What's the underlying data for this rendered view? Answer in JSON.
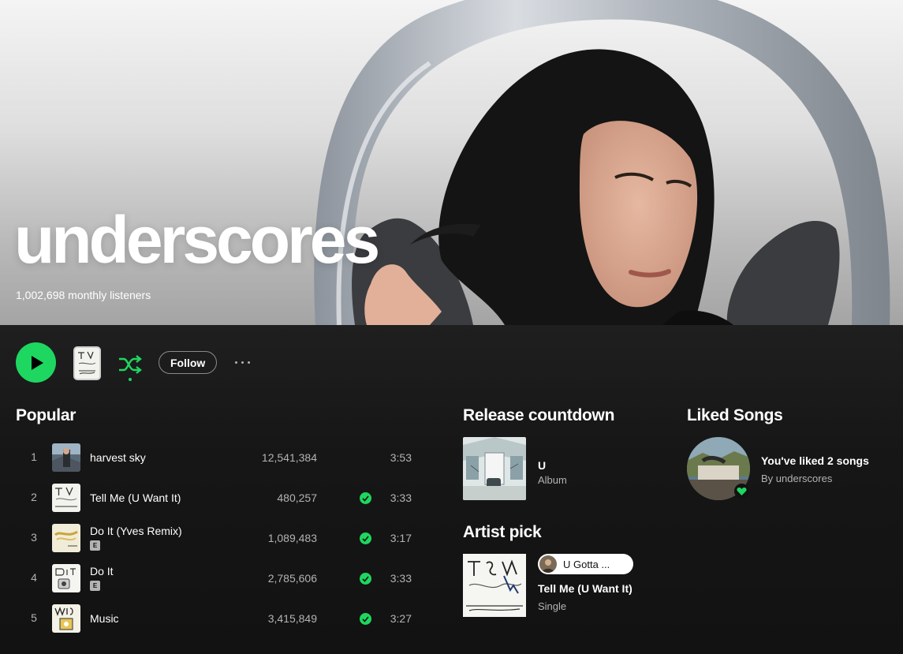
{
  "artist": {
    "name": "underscores",
    "monthly_listeners": "1,002,698 monthly listeners"
  },
  "actions": {
    "play_icon": "play-icon",
    "shuffle_icon": "shuffle-icon",
    "follow_label": "Follow",
    "more_icon": "more-options-icon"
  },
  "popular": {
    "title": "Popular",
    "tracks": [
      {
        "num": "1",
        "title": "harvest sky",
        "plays": "12,541,384",
        "duration": "3:53",
        "explicit": false,
        "liked": false
      },
      {
        "num": "2",
        "title": "Tell Me (U Want It)",
        "plays": "480,257",
        "duration": "3:33",
        "explicit": false,
        "liked": true
      },
      {
        "num": "3",
        "title": "Do It (Yves Remix)",
        "plays": "1,089,483",
        "duration": "3:17",
        "explicit": true,
        "liked": true
      },
      {
        "num": "4",
        "title": "Do It",
        "plays": "2,785,606",
        "duration": "3:33",
        "explicit": true,
        "liked": true
      },
      {
        "num": "5",
        "title": "Music",
        "plays": "3,415,849",
        "duration": "3:27",
        "explicit": false,
        "liked": true
      }
    ],
    "explicit_badge": "E"
  },
  "release_countdown": {
    "title": "Release countdown",
    "item_title": "U",
    "item_type": "Album"
  },
  "artist_pick": {
    "title": "Artist pick",
    "pill_text": "U Gotta ...",
    "item_title": "Tell Me (U Want It)",
    "item_type": "Single"
  },
  "liked_songs": {
    "title": "Liked Songs",
    "summary": "You've liked 2 songs",
    "by": "By underscores"
  },
  "colors": {
    "accent": "#1ed760",
    "background": "#121212",
    "secondary_text": "#b3b3b3"
  }
}
